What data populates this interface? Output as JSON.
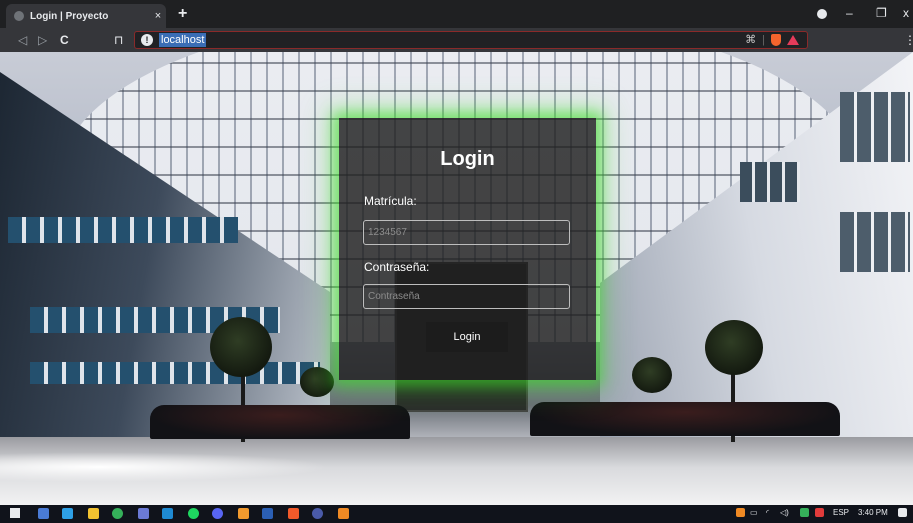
{
  "browser": {
    "tab_title": "Login | Proyecto",
    "tab_close": "×",
    "new_tab": "+",
    "url": "localhost",
    "info_icon": "!",
    "extension_icon": "⌘",
    "menu": "⋮",
    "minimize": "–",
    "maximize": "❐",
    "close": "x",
    "back": "◁",
    "forward": "▷",
    "reload": "C",
    "bookmark": "⊓"
  },
  "login": {
    "title": "Login",
    "matricula_label": "Matrícula:",
    "matricula_placeholder": "1234567",
    "password_label": "Contraseña:",
    "password_placeholder": "Contraseña",
    "submit_label": "Login"
  },
  "taskbar": {
    "icons": [
      "start-icon",
      "task-view-icon",
      "file-explorer-icon",
      "sticky-notes-icon",
      "maps-icon",
      "steam-icon",
      "vscode-icon",
      "spotify-icon",
      "discord-icon",
      "sublime-icon",
      "word-icon",
      "brave-icon",
      "obs-icon",
      "xampp-icon"
    ],
    "language": "ESP",
    "time": "3:40 PM"
  },
  "colors": {
    "card_glow": "#3cdc28",
    "taskbar_bg": "#10131b",
    "url_highlight": "#3a6db5"
  }
}
